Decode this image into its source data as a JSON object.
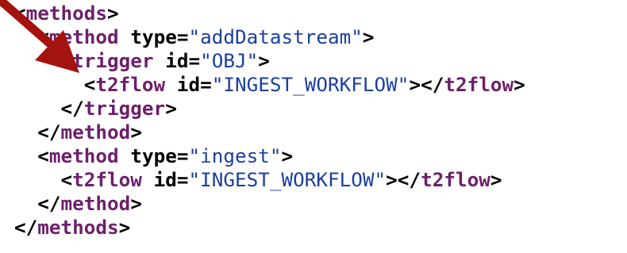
{
  "code": {
    "lines": [
      {
        "indent": "",
        "parts": [
          {
            "kind": "punct",
            "text": "<"
          },
          {
            "kind": "tag",
            "text": "methods"
          },
          {
            "kind": "punct",
            "text": ">"
          }
        ]
      },
      {
        "indent": "  ",
        "parts": [
          {
            "kind": "punct",
            "text": "<"
          },
          {
            "kind": "tag",
            "text": "method"
          },
          {
            "kind": "punct",
            "text": " "
          },
          {
            "kind": "attr",
            "text": "type"
          },
          {
            "kind": "punct",
            "text": "="
          },
          {
            "kind": "val",
            "text": "\"addDatastream\""
          },
          {
            "kind": "punct",
            "text": ">"
          }
        ]
      },
      {
        "indent": "    ",
        "parts": [
          {
            "kind": "punct",
            "text": "<"
          },
          {
            "kind": "tag",
            "text": "trigger"
          },
          {
            "kind": "punct",
            "text": " "
          },
          {
            "kind": "attr",
            "text": "id"
          },
          {
            "kind": "punct",
            "text": "="
          },
          {
            "kind": "val",
            "text": "\"OBJ\""
          },
          {
            "kind": "punct",
            "text": ">"
          }
        ]
      },
      {
        "indent": "      ",
        "parts": [
          {
            "kind": "punct",
            "text": "<"
          },
          {
            "kind": "tag",
            "text": "t2flow"
          },
          {
            "kind": "punct",
            "text": " "
          },
          {
            "kind": "attr",
            "text": "id"
          },
          {
            "kind": "punct",
            "text": "="
          },
          {
            "kind": "val",
            "text": "\"INGEST_WORKFLOW\""
          },
          {
            "kind": "punct",
            "text": "></"
          },
          {
            "kind": "tag",
            "text": "t2flow"
          },
          {
            "kind": "punct",
            "text": ">"
          }
        ]
      },
      {
        "indent": "    ",
        "parts": [
          {
            "kind": "punct",
            "text": "</"
          },
          {
            "kind": "tag",
            "text": "trigger"
          },
          {
            "kind": "punct",
            "text": ">"
          }
        ]
      },
      {
        "indent": "  ",
        "parts": [
          {
            "kind": "punct",
            "text": "</"
          },
          {
            "kind": "tag",
            "text": "method"
          },
          {
            "kind": "punct",
            "text": ">"
          }
        ]
      },
      {
        "indent": "  ",
        "parts": [
          {
            "kind": "punct",
            "text": "<"
          },
          {
            "kind": "tag",
            "text": "method"
          },
          {
            "kind": "punct",
            "text": " "
          },
          {
            "kind": "attr",
            "text": "type"
          },
          {
            "kind": "punct",
            "text": "="
          },
          {
            "kind": "val",
            "text": "\"ingest\""
          },
          {
            "kind": "punct",
            "text": ">"
          }
        ]
      },
      {
        "indent": "    ",
        "parts": [
          {
            "kind": "punct",
            "text": "<"
          },
          {
            "kind": "tag",
            "text": "t2flow"
          },
          {
            "kind": "punct",
            "text": " "
          },
          {
            "kind": "attr",
            "text": "id"
          },
          {
            "kind": "punct",
            "text": "="
          },
          {
            "kind": "val",
            "text": "\"INGEST_WORKFLOW\""
          },
          {
            "kind": "punct",
            "text": "></"
          },
          {
            "kind": "tag",
            "text": "t2flow"
          },
          {
            "kind": "punct",
            "text": ">"
          }
        ]
      },
      {
        "indent": "  ",
        "parts": [
          {
            "kind": "punct",
            "text": "</"
          },
          {
            "kind": "tag",
            "text": "method"
          },
          {
            "kind": "punct",
            "text": ">"
          }
        ]
      },
      {
        "indent": "",
        "parts": [
          {
            "kind": "punct",
            "text": "</"
          },
          {
            "kind": "tag",
            "text": "methods"
          },
          {
            "kind": "punct",
            "text": ">"
          }
        ]
      }
    ]
  },
  "colors": {
    "tag": "#6d1f6b",
    "value": "#1b3fa1",
    "attribute": "#000000",
    "arrow": "#a3140f"
  },
  "annotation": {
    "icon": "arrow-pointer-icon"
  }
}
